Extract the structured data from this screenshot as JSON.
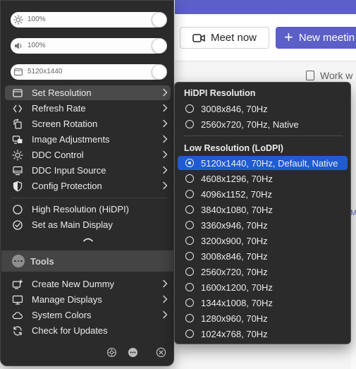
{
  "background": {
    "meet_now": "Meet now",
    "new_meeting": "New meetin",
    "work_label": "Work w",
    "me_fragment": "Me"
  },
  "sliders": [
    {
      "icon": "brightness-icon",
      "value": "100%"
    },
    {
      "icon": "volume-icon",
      "value": "100%"
    },
    {
      "icon": "display-resolution-icon",
      "value": "5120x1440"
    }
  ],
  "menu": {
    "items": [
      {
        "label": "Set Resolution",
        "icon": "display-icon",
        "submenu": true
      },
      {
        "label": "Refresh Rate",
        "icon": "refresh-rate-icon",
        "submenu": true
      },
      {
        "label": "Screen Rotation",
        "icon": "rotation-icon",
        "submenu": true
      },
      {
        "label": "Image Adjustments",
        "icon": "image-adjust-icon",
        "submenu": true
      },
      {
        "label": "DDC Control",
        "icon": "sun-icon",
        "submenu": true
      },
      {
        "label": "DDC Input Source",
        "icon": "input-source-icon",
        "submenu": true
      },
      {
        "label": "Config Protection",
        "icon": "shield-icon",
        "submenu": true
      }
    ],
    "options": [
      {
        "label": "High Resolution (HiDPI)",
        "icon": "radio-empty-icon"
      },
      {
        "label": "Set as Main Display",
        "icon": "checkmark-circle-icon"
      }
    ],
    "tools_title": "Tools",
    "tools": [
      {
        "label": "Create New Dummy",
        "icon": "add-display-icon",
        "submenu": true
      },
      {
        "label": "Manage Displays",
        "icon": "monitor-icon",
        "submenu": true
      },
      {
        "label": "System Colors",
        "icon": "cloud-icon",
        "submenu": true
      },
      {
        "label": "Check for Updates",
        "icon": "refresh-icon",
        "submenu": false
      }
    ],
    "footer": [
      "gear-icon",
      "more-icon",
      "close-icon"
    ]
  },
  "submenu": {
    "hidpi_header": "HiDPI Resolution",
    "hidpi": [
      {
        "label": "3008x846, 70Hz",
        "selected": false
      },
      {
        "label": "2560x720, 70Hz, Native",
        "selected": false
      }
    ],
    "lodpi_header": "Low Resolution (LoDPI)",
    "lodpi": [
      {
        "label": "5120x1440, 70Hz, Default, Native",
        "selected": true
      },
      {
        "label": "4608x1296, 70Hz",
        "selected": false
      },
      {
        "label": "4096x1152, 70Hz",
        "selected": false
      },
      {
        "label": "3840x1080, 70Hz",
        "selected": false
      },
      {
        "label": "3360x946, 70Hz",
        "selected": false
      },
      {
        "label": "3200x900, 70Hz",
        "selected": false
      },
      {
        "label": "3008x846, 70Hz",
        "selected": false
      },
      {
        "label": "2560x720, 70Hz",
        "selected": false
      },
      {
        "label": "1600x1200, 70Hz",
        "selected": false
      },
      {
        "label": "1344x1008, 70Hz",
        "selected": false
      },
      {
        "label": "1280x960, 70Hz",
        "selected": false
      },
      {
        "label": "1024x768, 70Hz",
        "selected": false
      }
    ]
  },
  "colors": {
    "menu_bg": "#2b2b2b",
    "highlight": "#4a4a4a",
    "selection": "#1f5bd1",
    "brand": "#5b5fc7"
  }
}
